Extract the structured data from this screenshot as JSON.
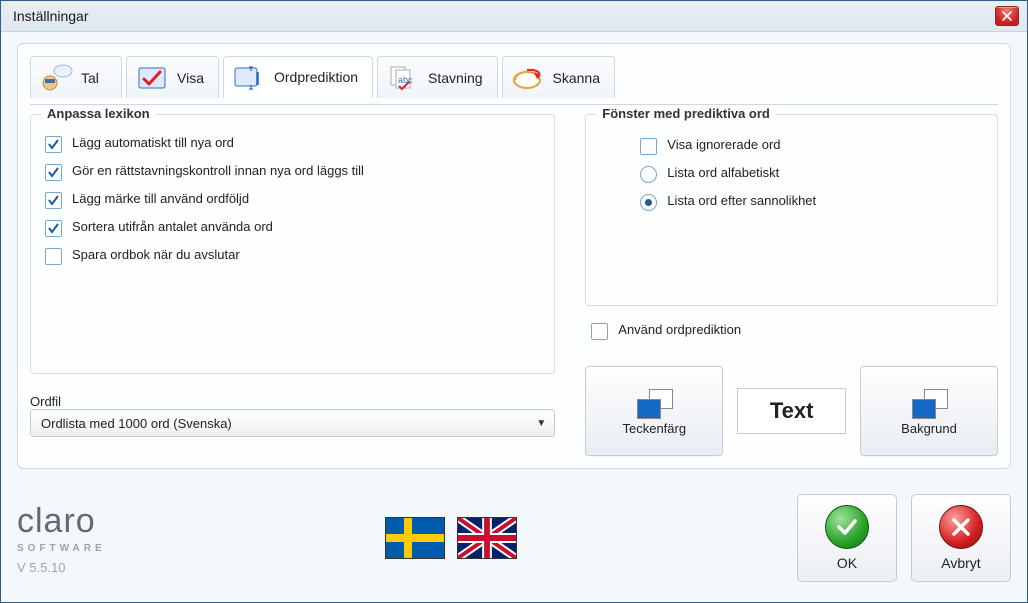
{
  "window": {
    "title": "Inställningar"
  },
  "tabs": [
    {
      "label": "Tal"
    },
    {
      "label": "Visa"
    },
    {
      "label": "Ordprediktion"
    },
    {
      "label": "Stavning"
    },
    {
      "label": "Skanna"
    }
  ],
  "groups": {
    "anpassa": {
      "title": "Anpassa lexikon",
      "items": [
        {
          "label": "Lägg automatiskt till nya ord",
          "checked": true
        },
        {
          "label": "Gör en rättstavningskontroll innan nya ord läggs till",
          "checked": true
        },
        {
          "label": "Lägg märke till använd ordföljd",
          "checked": true
        },
        {
          "label": "Sortera utifrån antalet använda ord",
          "checked": true
        },
        {
          "label": "Spara ordbok när du avslutar",
          "checked": false
        }
      ]
    },
    "fonster": {
      "title": "Fönster med prediktiva ord",
      "check": {
        "label": "Visa ignorerade ord",
        "checked": false
      },
      "radios": [
        {
          "label": "Lista ord alfabetiskt",
          "selected": false
        },
        {
          "label": "Lista ord efter sannolikhet",
          "selected": true
        }
      ]
    }
  },
  "ordfil": {
    "label": "Ordfil",
    "value": "Ordlista med 1000 ord (Svenska)"
  },
  "prediction_toggle": {
    "label": "Använd ordprediktion",
    "checked": false
  },
  "color_buttons": {
    "fg": "Teckenfärg",
    "bg": "Bakgrund"
  },
  "preview_text": "Text",
  "logo": {
    "name": "claro",
    "sub": "SOFTWARE",
    "version": "V 5.5.10"
  },
  "buttons": {
    "ok": "OK",
    "cancel": "Avbryt"
  }
}
